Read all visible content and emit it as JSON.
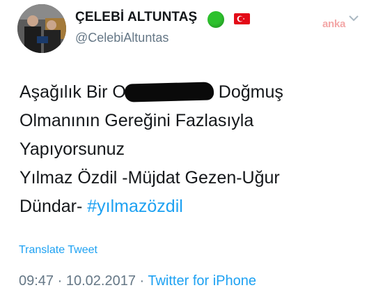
{
  "author": {
    "display_name": "ÇELEBİ ALTUNTAŞ",
    "handle": "@CelebiAltuntas",
    "avatar_icon": "profile-photo",
    "badge_icon": "green-circle-icon",
    "flag_icon": "turkey-flag-icon"
  },
  "watermark": "anka",
  "tweet": {
    "line1_before": "Aşağılık Bir O",
    "line1_after": " Doğmuş",
    "line2": "Olmanının Gereğini Fazlasıyla",
    "line3": "Yapıyorsunuz",
    "line4": "Yılmaz Özdil -Müjdat Gezen-Uğur",
    "line5_text": "Dündar- ",
    "hashtag": "#yılmazözdil"
  },
  "translate_label": "Translate Tweet",
  "meta": {
    "time": "09:47",
    "separator": " · ",
    "date": "10.02.2017",
    "separator2": " · ",
    "source": "Twitter for iPhone"
  },
  "colors": {
    "link": "#1da1f2",
    "secondary_text": "#657786",
    "primary_text": "#14171a",
    "badge_green": "#2ec12e",
    "flag_red": "#e30a17"
  }
}
